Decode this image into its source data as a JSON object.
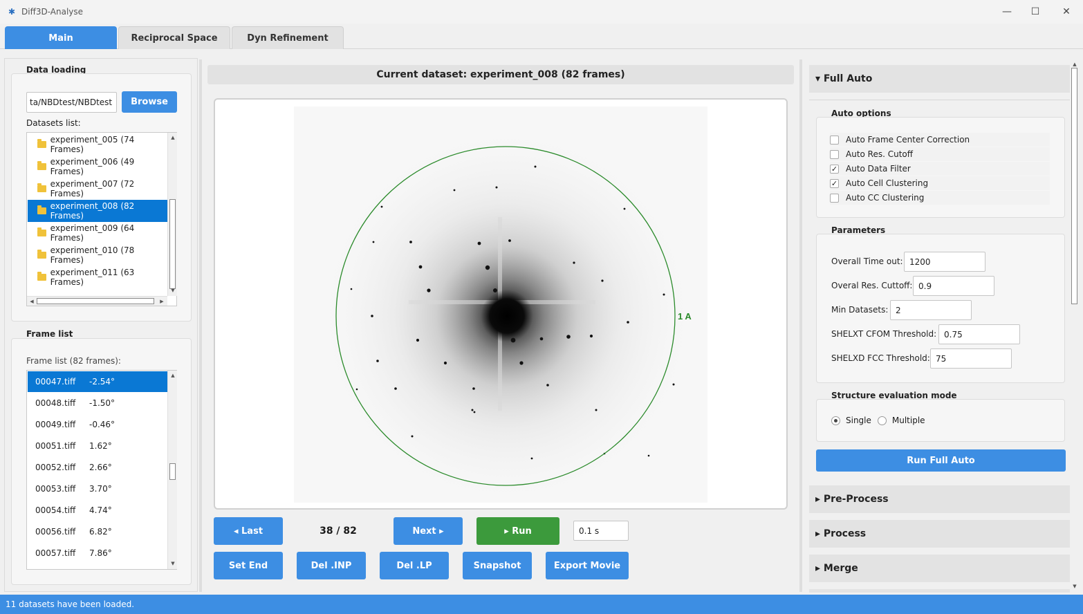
{
  "window": {
    "title": "Diff3D-Analyse",
    "minimize_glyph": "—",
    "maximize_glyph": "☐",
    "close_glyph": "✕"
  },
  "tabs": [
    {
      "label": "Main",
      "active": true
    },
    {
      "label": "Reciprocal Space",
      "active": false
    },
    {
      "label": "Dyn Refinement",
      "active": false
    }
  ],
  "data_loading": {
    "title": "Data loading",
    "path_value": "ta/NBDtest/NBDtest",
    "browse_label": "Browse",
    "datasets_label": "Datasets list:",
    "datasets": [
      "experiment_005 (74 Frames)",
      "experiment_006 (49 Frames)",
      "experiment_007 (72 Frames)",
      "experiment_008 (82 Frames)",
      "experiment_009 (64 Frames)",
      "experiment_010 (78 Frames)",
      "experiment_011 (63 Frames)"
    ],
    "selected_index": 3
  },
  "frame_list": {
    "title": "Frame list",
    "subtitle": "Frame list (82 frames):",
    "frames": [
      {
        "file": "00047.tiff",
        "angle": "-2.54°"
      },
      {
        "file": "00048.tiff",
        "angle": "-1.50°"
      },
      {
        "file": "00049.tiff",
        "angle": "-0.46°"
      },
      {
        "file": "00051.tiff",
        "angle": "1.62°"
      },
      {
        "file": "00052.tiff",
        "angle": "2.66°"
      },
      {
        "file": "00053.tiff",
        "angle": "3.70°"
      },
      {
        "file": "00054.tiff",
        "angle": "4.74°"
      },
      {
        "file": "00056.tiff",
        "angle": "6.82°"
      },
      {
        "file": "00057.tiff",
        "angle": "7.86°"
      }
    ],
    "selected_index": 0
  },
  "viewer": {
    "header": "Current dataset: experiment_008 (82 frames)",
    "ring_label": "1 A",
    "ring_color": "#2a8a2a",
    "frame_counter": "38 / 82",
    "interval_value": "0.1 s"
  },
  "controls": {
    "last_label": "◂ Last",
    "next_label": "Next ▸",
    "run_label": "▸ Run",
    "set_end_label": "Set End",
    "del_inp_label": "Del .INP",
    "del_lp_label": "Del .LP",
    "snapshot_label": "Snapshot",
    "export_movie_label": "Export Movie"
  },
  "full_auto": {
    "header": "▾ Full Auto",
    "auto_options_title": "Auto options",
    "options": [
      {
        "label": "Auto Frame Center Correction",
        "checked": false
      },
      {
        "label": "Auto Res. Cutoff",
        "checked": false
      },
      {
        "label": "Auto Data Filter",
        "checked": true
      },
      {
        "label": "Auto Cell Clustering",
        "checked": true
      },
      {
        "label": "Auto CC Clustering",
        "checked": false
      }
    ],
    "parameters_title": "Parameters",
    "parameters": [
      {
        "label": "Overall Time out:",
        "value": "1200"
      },
      {
        "label": "Overal Res. Cuttoff:",
        "value": "0.9"
      },
      {
        "label": "Min Datasets:",
        "value": "2"
      },
      {
        "label": "SHELXT CFOM Threshold:",
        "value": "0.75"
      },
      {
        "label": "SHELXD FCC Threshold:",
        "value": "75"
      }
    ],
    "eval_mode_title": "Structure evaluation mode",
    "eval_single": "Single",
    "eval_multiple": "Multiple",
    "run_label": "Run Full Auto"
  },
  "sections": {
    "preprocess": "▸ Pre-Process",
    "process": "▸ Process",
    "merge": "▸ Merge"
  },
  "status": {
    "text": "11 datasets have been loaded."
  },
  "colors": {
    "accent": "#3d8ee3",
    "selection": "#0a78d4",
    "run_green": "#3c9a3c"
  }
}
